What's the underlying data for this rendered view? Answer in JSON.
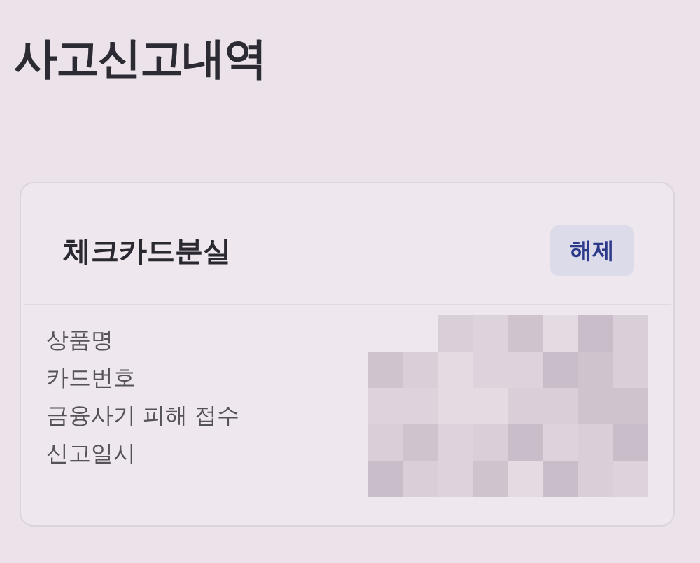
{
  "title": "사고신고내역",
  "report": {
    "name": "체크카드분실",
    "action": "해제",
    "fields": [
      {
        "label": "상품명"
      },
      {
        "label": "카드번호"
      },
      {
        "label": "금융사기 피해 접수"
      },
      {
        "label": "신고일시"
      }
    ]
  }
}
